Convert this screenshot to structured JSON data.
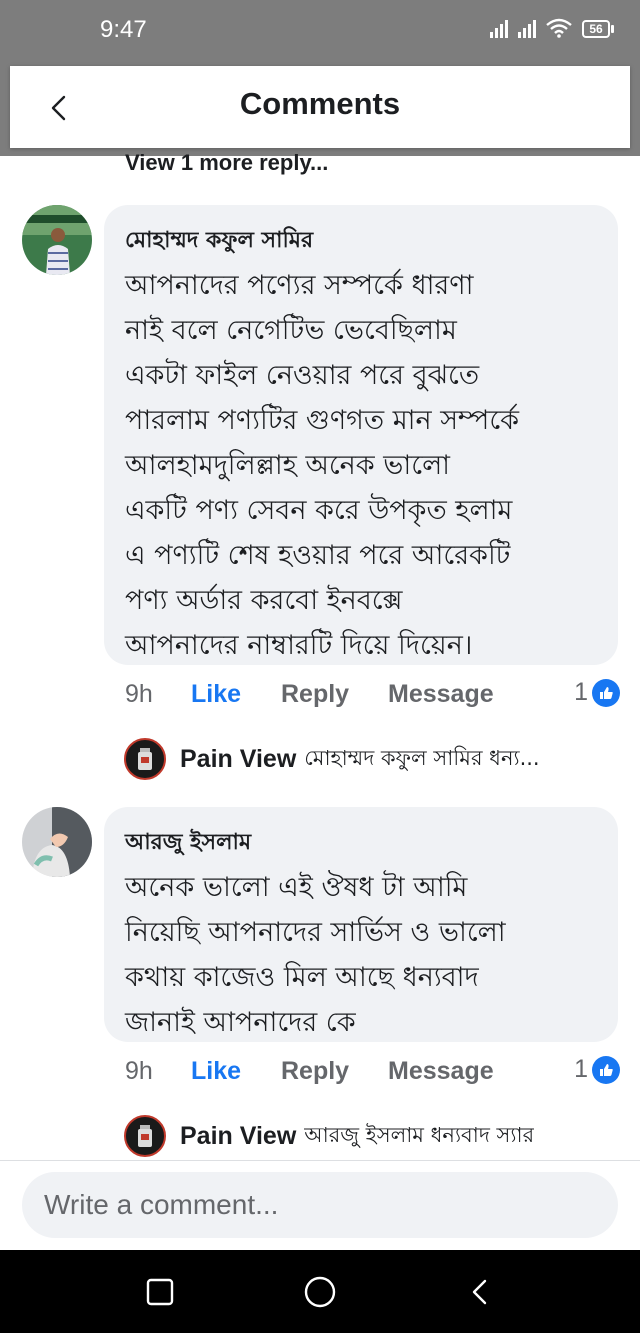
{
  "status_bar": {
    "time": "9:47",
    "battery": "56",
    "icons": [
      "signal-icon",
      "signal-icon",
      "wifi-icon",
      "battery-icon"
    ]
  },
  "header": {
    "title": "Comments",
    "back_icon": "chevron-left-icon"
  },
  "view_more": "View 1 more reply...",
  "comments": [
    {
      "author": "মোহাম্মদ কফুল সামির",
      "text": "আপনাদের পণ্যের সম্পর্কে ধারণা\nনাই বলে নেগেটিভ ভেবেছিলাম\nএকটা ফাইল নেওয়ার পরে বুঝতে\nপারলাম পণ্যটির গুণগত মান সম্পর্কে\nআলহামদুলিল্লাহ অনেক ভালো\nএকটি পণ্য সেবন করে উপকৃত হলাম\nএ পণ্যটি শেষ হওয়ার পরে আরেকটি\nপণ্য অর্ডার করবো ইনবক্সে\nআপনাদের নাম্বারটি দিয়ে দিয়েন।",
      "time": "9h",
      "like": "Like",
      "reply": "Reply",
      "message": "Message",
      "reaction_count": "1",
      "reply_preview": {
        "name": "Pain View",
        "text": "মোহাম্মদ কফুল সামির ধন্য..."
      }
    },
    {
      "author": "আরজু ইসলাম",
      "text": "অনেক ভালো এই ঔষধ টা আমি\nনিয়েছি আপনাদের  সার্ভিস ও ভালো\nকথায় কাজেও মিল আছে ধন্যবাদ\nজানাই আপনাদের কে",
      "time": "9h",
      "like": "Like",
      "reply": "Reply",
      "message": "Message",
      "reaction_count": "1",
      "reply_preview": {
        "name": "Pain View",
        "text": "আরজু ইসলাম ধন্যবাদ স্যার"
      }
    }
  ],
  "composer": {
    "placeholder": "Write a comment..."
  },
  "nav_bar": {
    "buttons": [
      "recent-apps-icon",
      "home-icon",
      "back-icon"
    ]
  },
  "colors": {
    "accent": "#1877f2",
    "bubble": "#f0f2f5",
    "secondary_text": "#65676b",
    "status_bar": "#7d7d7d"
  }
}
